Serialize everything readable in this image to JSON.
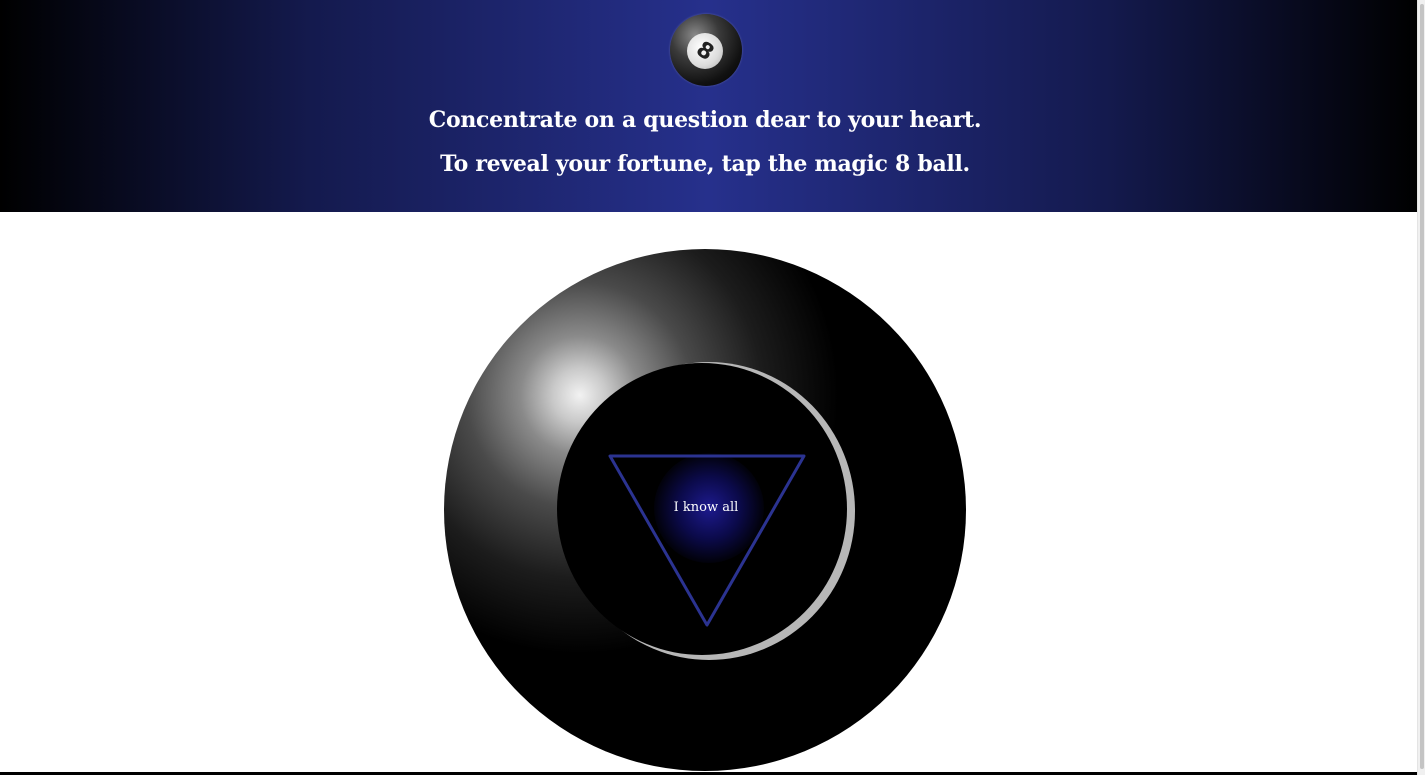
{
  "header": {
    "logo_icon": "magic-8-ball-icon",
    "logo_glyph": "8",
    "instruction_line_1": "Concentrate on a question dear to your heart.",
    "instruction_line_2": "To reveal your fortune, tap the magic 8 ball."
  },
  "ball": {
    "answer_text": "I know all",
    "triangle_color": "#2b3391",
    "glow_color": "#1d1a8e"
  },
  "colors": {
    "header_center": "#26308c",
    "header_edge": "#000000",
    "background": "#ffffff"
  }
}
